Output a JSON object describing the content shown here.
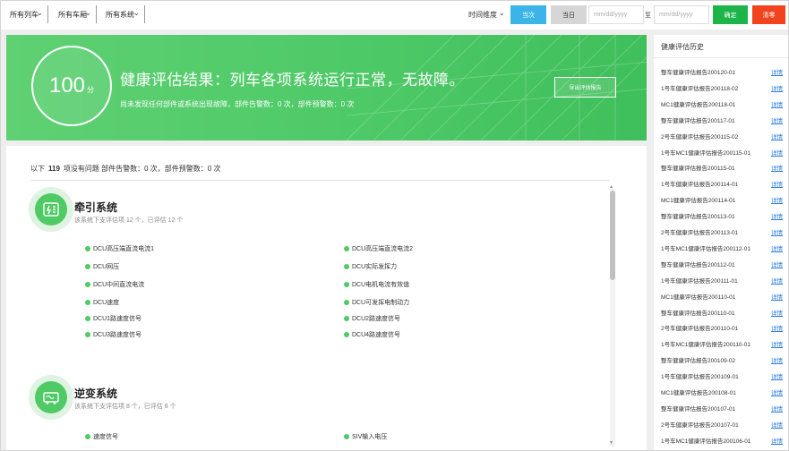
{
  "toolbar": {
    "selects": [
      "所有列车",
      "所有车厢",
      "所有系统"
    ],
    "date_type": "时间维度",
    "btn_day": "当次",
    "btn_today": "当日",
    "date_placeholder_start": "mm/dd/yyyy",
    "date_to_label": "至",
    "date_placeholder_end": "mm/dd/yyyy",
    "btn_confirm": "确定",
    "btn_reset": "清零",
    "colors": {
      "blue": "#3bb5e8",
      "gray": "#d6d6d6",
      "green": "#1db54a",
      "red": "#f0431e"
    }
  },
  "banner": {
    "score": "100",
    "score_unit": "分",
    "title": "健康评估结果：列车各项系统运行正常，无故障。",
    "subtitle": "尚未发现任何部件或系统出现故障，部件告警数：0 次，部件预警数：0 次",
    "report_button": "导出评估报告",
    "color": "#4ec967"
  },
  "summary": {
    "prefix": "以下",
    "count": "119",
    "text": "项没有问题  部件告警数：0 次，部件预警数：0 次"
  },
  "systems": [
    {
      "title": "牵引系统",
      "sub": "该系统下支评估项 12 个，已评估 12 个",
      "icon": "battery-panel-icon",
      "items_left": [
        "DCU高压端直流电流1",
        "DCU网压",
        "DCU中间直流电流",
        "DCU速度",
        "DCU1路速度信号",
        "DCU3路速度信号"
      ],
      "items_right": [
        "DCU高压端直流电流2",
        "DCU实际发挥力",
        "DCU电机电流有效值",
        "DCU可发挥电制动力",
        "DCU2路速度信号",
        "DCU4路速度信号"
      ]
    },
    {
      "title": "逆变系统",
      "sub": "该系统下支评估项 8 个，已评估 8 个",
      "icon": "inverter-icon",
      "items_left": [
        "速度信号"
      ],
      "items_right": [
        "SIV输入电压"
      ]
    }
  ],
  "sidebar": {
    "title": "健康评估历史",
    "link_label": "详情",
    "reports": [
      "整车健康评估报告200120-01",
      "1号车健康评估报告200118-02",
      "MC1健康评估报告200118-01",
      "整车健康评估报告200117-01",
      "2号车健康评估报告200115-02",
      "1号车MC1健康评估报告200115-01",
      "整车健康评估报告200115-01",
      "1号车健康评估报告200114-01",
      "MC1健康评估报告200114-01",
      "整车健康评估报告200113-01",
      "2号车健康评估报告200113-01",
      "1号车MC1健康评估报告200112-01",
      "整车健康评估报告200112-01",
      "1号车健康评估报告200111-01",
      "MC1健康评估报告200110-01",
      "整车健康评估报告200110-01",
      "2号车健康评估报告200110-01",
      "1号车MC1健康评估报告200110-01",
      "整车健康评估报告200109-02",
      "1号车健康评估报告200109-01",
      "MC1健康评估报告200108-01",
      "整车健康评估报告200107-01",
      "2号车健康评估报告200107-01",
      "1号车MC1健康评估报告200106-01"
    ]
  }
}
